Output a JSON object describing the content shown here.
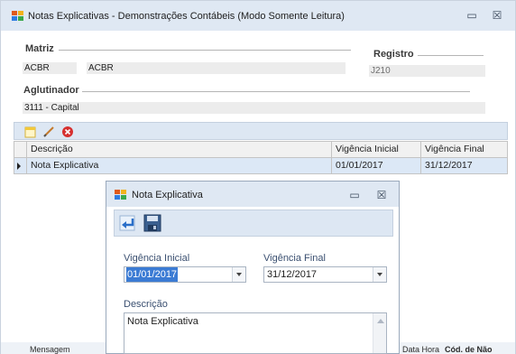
{
  "window": {
    "title": "Notas Explicativas - Demonstrações Contábeis (Modo Somente Leitura)",
    "minimize_glyph": "▭",
    "close_glyph": "☒"
  },
  "matriz": {
    "label": "Matriz",
    "code": "ACBR",
    "name": "ACBR"
  },
  "registro": {
    "label": "Registro",
    "value": "J210"
  },
  "aglutinador": {
    "label": "Aglutinador",
    "value": "3111 - Capital"
  },
  "toolbar": {
    "icons": [
      "new-icon",
      "edit-icon",
      "delete-icon"
    ]
  },
  "grid": {
    "columns": [
      "Descrição",
      "Vigência Inicial",
      "Vigência Final"
    ],
    "rows": [
      {
        "descricao": "Nota Explicativa",
        "vigencia_inicial": "01/01/2017",
        "vigencia_final": "31/12/2017"
      }
    ]
  },
  "bottom": {
    "left_text": "Mensagem",
    "right_text": "Data Hora",
    "right_bold": "Cód. de Não"
  },
  "dialog": {
    "title": "Nota Explicativa",
    "minimize_glyph": "▭",
    "close_glyph": "☒",
    "toolbar_icons": [
      "return-icon",
      "save-icon"
    ],
    "vigencia_inicial_label": "Vigência Inicial",
    "vigencia_inicial_value": "01/01/2017",
    "vigencia_final_label": "Vigência Final",
    "vigencia_final_value": "31/12/2017",
    "descricao_label": "Descrição",
    "descricao_value": "Nota Explicativa"
  },
  "colors": {
    "titlebar": "#dfe8f3",
    "selection": "#3b7bd4",
    "row_highlight": "#dce8f6"
  }
}
